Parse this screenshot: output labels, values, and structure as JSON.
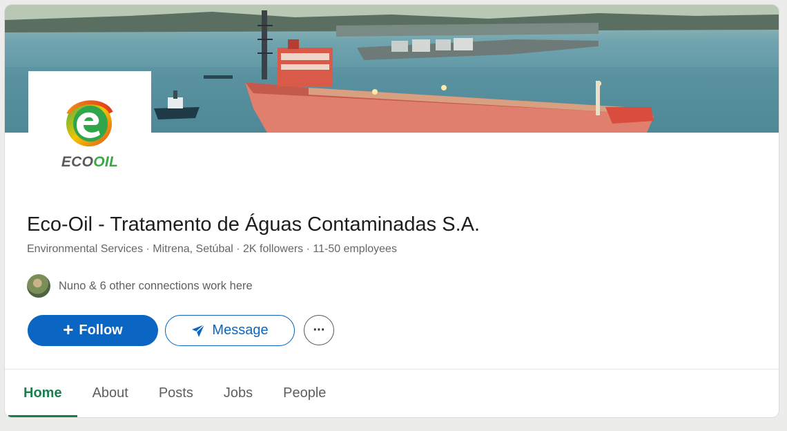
{
  "company": {
    "logo": {
      "word_left": "ECO",
      "word_right": "OIL",
      "icon": "eco-oil-logo-e-icon"
    },
    "name": "Eco-Oil - Tratamento de Águas Contaminadas S.A.",
    "meta": "Environmental Services · Mitrena, Setúbal · 2K followers · 11-50 employees",
    "connections_text": "Nuno & 6 other connections work here"
  },
  "actions": {
    "follow_label": "Follow",
    "follow_icon": "plus-icon",
    "message_label": "Message",
    "message_icon": "send-arrow-icon",
    "more_label": "···",
    "more_icon": "more-options-icon"
  },
  "tabs": [
    {
      "label": "Home",
      "active": true
    },
    {
      "label": "About",
      "active": false
    },
    {
      "label": "Posts",
      "active": false
    },
    {
      "label": "Jobs",
      "active": false
    },
    {
      "label": "People",
      "active": false
    }
  ],
  "colors": {
    "primary": "#0a66c2",
    "active_tab": "#1a7f4f",
    "logo_green": "#3fa646"
  }
}
